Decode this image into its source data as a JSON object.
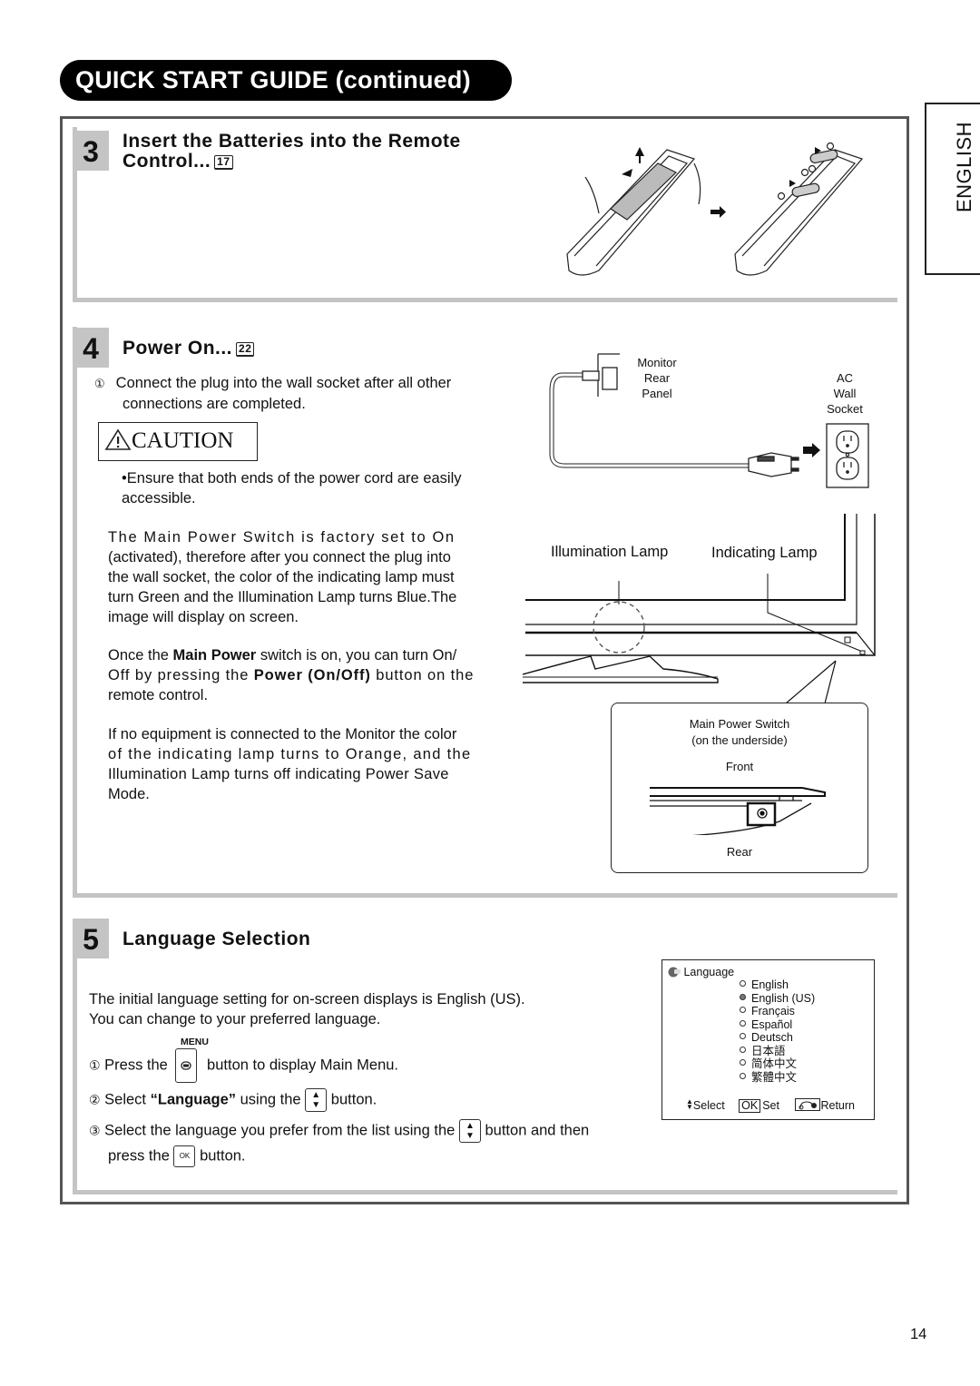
{
  "header": {
    "title": "QUICK START GUIDE (continued)",
    "language_tab": "ENGLISH"
  },
  "sections": {
    "batteries": {
      "number": "3",
      "title_line1": "Insert the Batteries into the Remote",
      "title_line2": "Control...",
      "page_ref": "17",
      "illustration": "remote-battery-insertion-diagram"
    },
    "power_on": {
      "number": "4",
      "title": "Power On...",
      "page_ref": "22",
      "step1_marker": "①",
      "step1_line1": "Connect the plug into the wall socket after all  other",
      "step1_line2": "connections are completed.",
      "caution_label": "CAUTION",
      "caution_bullet": "•",
      "caution_line1": "Ensure that both ends of the power cord are easily",
      "caution_line2": "accessible.",
      "para1": [
        "The Main Power Switch is factory set to On",
        "(activated), therefore after you connect the plug into",
        "the wall socket, the color of the indicating lamp must",
        "turn Green and the Illumination Lamp turns Blue.The",
        "image will display on screen."
      ],
      "para2": {
        "l1_a": "Once the ",
        "l1_b": "Main Power",
        "l1_c": " switch is on, you can turn On/",
        "l2_a": "Off by pressing the ",
        "l2_b": "Power (On/Off)",
        "l2_c": " button on the",
        "l3": "remote control."
      },
      "para3": [
        "If no equipment is connected to the Monitor the color",
        "of the indicating lamp turns to Orange, and the",
        "Illumination Lamp turns off indicating Power Save",
        "Mode."
      ],
      "diagram": {
        "monitor_label": [
          "Monitor",
          "Rear",
          "Panel"
        ],
        "socket_label": [
          "AC",
          "Wall",
          "Socket"
        ],
        "illumination_lamp": "Illumination Lamp",
        "indicating_lamp": "Indicating Lamp",
        "callout_title": "Main Power Switch",
        "callout_subtitle": "(on the underside)",
        "callout_front": "Front",
        "callout_rear": "Rear"
      }
    },
    "language": {
      "number": "5",
      "title": "Language Selection",
      "intro_line1": "The initial language setting for on-screen displays is English (US).",
      "intro_line2": "You can change to your preferred language.",
      "menu_label": "MENU",
      "step1_marker": "①",
      "step1_a": "Press the",
      "step1_b": "button to display Main Menu.",
      "step2_marker": "②",
      "step2_a": "Select ",
      "step2_b": "“Language”",
      "step2_c": " using the",
      "step2_d": "button.",
      "step3_marker": "③",
      "step3_a": "Select the language you prefer from the list using the",
      "step3_b": "button and then",
      "step3_c": "press the",
      "step3_d": "button.",
      "ok_label": "OK",
      "osd": {
        "title": "Language",
        "options": [
          {
            "label": "English",
            "selected": false
          },
          {
            "label": "English (US)",
            "selected": true
          },
          {
            "label": "Français",
            "selected": false
          },
          {
            "label": "Español",
            "selected": false
          },
          {
            "label": "Deutsch",
            "selected": false
          },
          {
            "label": "日本語",
            "selected": false
          },
          {
            "label": "简体中文",
            "selected": false
          },
          {
            "label": "繁體中文",
            "selected": false
          }
        ],
        "footer_select": "Select",
        "footer_ok": "OK",
        "footer_set": "Set",
        "footer_return": "Return"
      }
    }
  },
  "page_number": "14"
}
